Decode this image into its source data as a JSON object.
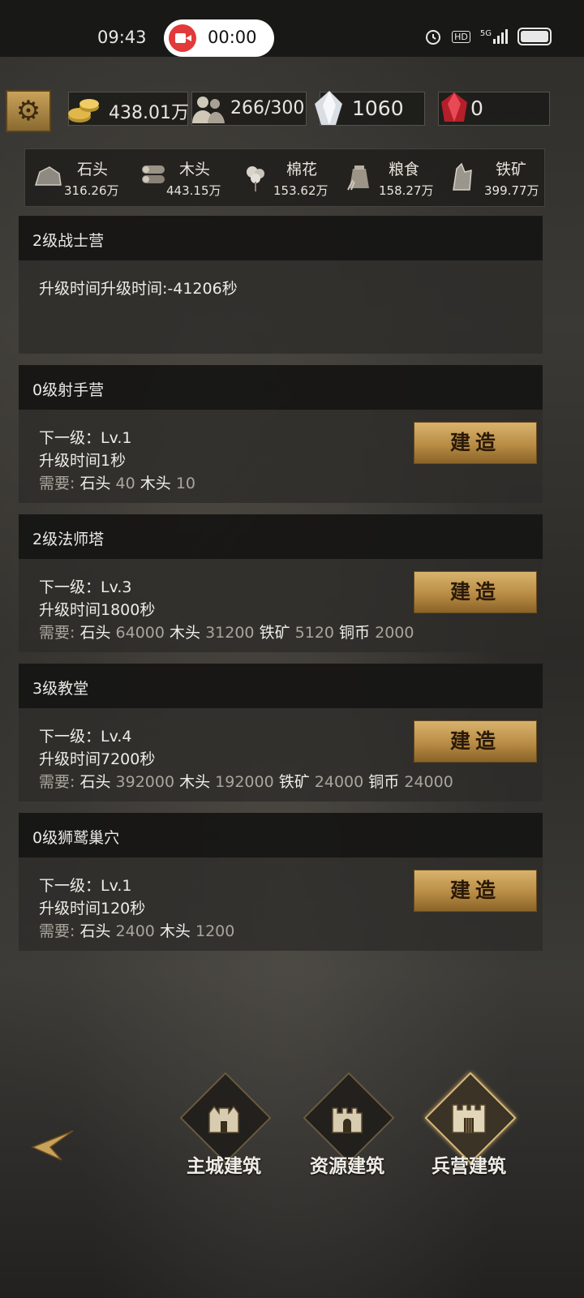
{
  "status_bar": {
    "time": "09:43",
    "rec_time": "00:00",
    "hd": "HD",
    "signal": "5G"
  },
  "resources": {
    "gold": "438.01万",
    "population": "266/300",
    "crystal": "1060",
    "ruby": "0"
  },
  "materials": [
    {
      "name": "石头",
      "value": "316.26万"
    },
    {
      "name": "木头",
      "value": "443.15万"
    },
    {
      "name": "棉花",
      "value": "153.62万"
    },
    {
      "name": "粮食",
      "value": "158.27万"
    },
    {
      "name": "铁矿",
      "value": "399.77万"
    }
  ],
  "buildings": [
    {
      "title": "2级战士营",
      "upgrade": "升级时间升级时间:-41206秒"
    },
    {
      "title": "0级射手营",
      "next": "下一级：Lv.1",
      "time": "升级时间1秒",
      "req_label": "需要:",
      "req": [
        {
          "name": "石头",
          "val": "40"
        },
        {
          "name": "木头",
          "val": "10"
        }
      ],
      "button": "建造"
    },
    {
      "title": "2级法师塔",
      "next": "下一级：Lv.3",
      "time": "升级时间1800秒",
      "req_label": "需要:",
      "req": [
        {
          "name": "石头",
          "val": "64000"
        },
        {
          "name": "木头",
          "val": "31200"
        },
        {
          "name": "铁矿",
          "val": "5120"
        },
        {
          "name": "铜币",
          "val": "2000"
        }
      ],
      "button": "建造"
    },
    {
      "title": "3级教堂",
      "next": "下一级：Lv.4",
      "time": "升级时间7200秒",
      "req_label": "需要:",
      "req": [
        {
          "name": "石头",
          "val": "392000"
        },
        {
          "name": "木头",
          "val": "192000"
        },
        {
          "name": "铁矿",
          "val": "24000"
        },
        {
          "name": "铜币",
          "val": "24000"
        }
      ],
      "button": "建造"
    },
    {
      "title": "0级狮鹫巢穴",
      "next": "下一级：Lv.1",
      "time": "升级时间120秒",
      "req_label": "需要:",
      "req": [
        {
          "name": "石头",
          "val": "2400"
        },
        {
          "name": "木头",
          "val": "1200"
        }
      ],
      "button": "建造"
    }
  ],
  "tabs": [
    {
      "label": "主城建筑",
      "active": false
    },
    {
      "label": "资源建筑",
      "active": false
    },
    {
      "label": "兵营建筑",
      "active": true
    }
  ],
  "colors": {
    "gold_button": "#c9a25a",
    "card_header": "#161615",
    "accent_text": "#eceae4"
  }
}
